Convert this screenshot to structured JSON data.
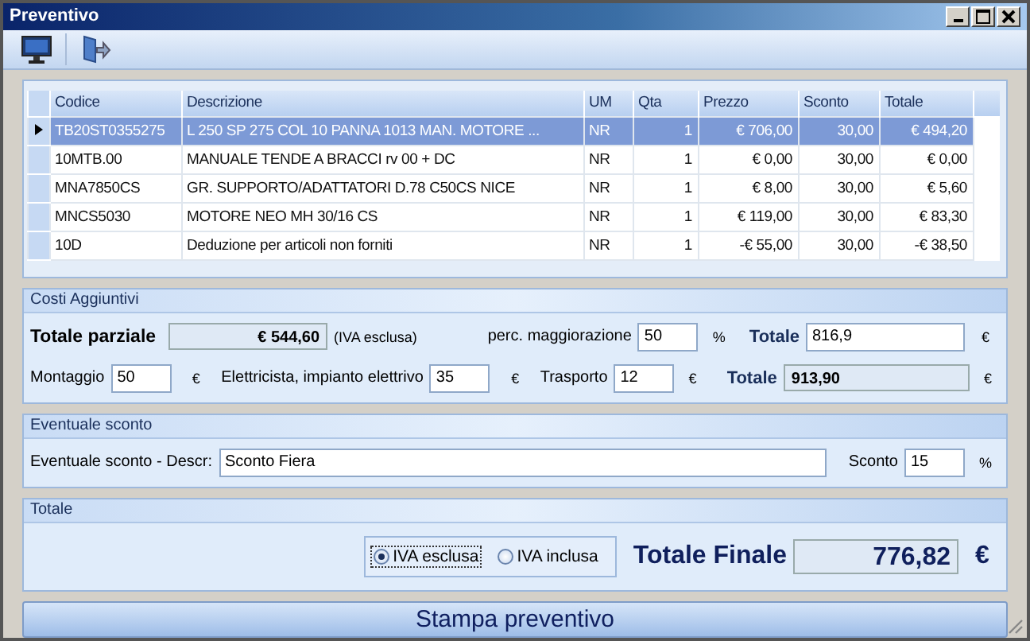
{
  "window": {
    "title": "Preventivo"
  },
  "table": {
    "columns": [
      "Codice",
      "Descrizione",
      "UM",
      "Qta",
      "Prezzo",
      "Sconto",
      "Totale"
    ],
    "rows": [
      {
        "cells": [
          "TB20ST0355275",
          "L 250 SP 275 COL 10 PANNA  1013 MAN. MOTORE ...",
          "NR",
          "1",
          "€ 706,00",
          "30,00",
          "€ 494,20"
        ],
        "selected": true
      },
      {
        "cells": [
          "10MTB.00",
          "MANUALE TENDE A BRACCI  rv 00 + DC",
          "NR",
          "1",
          "€ 0,00",
          "30,00",
          "€ 0,00"
        ],
        "selected": false
      },
      {
        "cells": [
          "MNA7850CS",
          "GR. SUPPORTO/ADATTATORI D.78 C50CS NICE",
          "NR",
          "1",
          "€ 8,00",
          "30,00",
          "€ 5,60"
        ],
        "selected": false
      },
      {
        "cells": [
          "MNCS5030",
          "MOTORE NEO MH 30/16 CS",
          "NR",
          "1",
          "€ 119,00",
          "30,00",
          "€ 83,30"
        ],
        "selected": false
      },
      {
        "cells": [
          "10D",
          "Deduzione per articoli non forniti",
          "NR",
          "1",
          "-€ 55,00",
          "30,00",
          "-€ 38,50"
        ],
        "selected": false
      }
    ]
  },
  "costi": {
    "title": "Costi Aggiuntivi",
    "subtotal_label": "Totale parziale",
    "subtotal": "€ 544,60",
    "subtotal_note": "(IVA esclusa)",
    "markup_label": "perc. maggiorazione",
    "markup": "50",
    "markup_unit": "%",
    "total_label": "Totale",
    "total": "816,9",
    "total_unit": "€",
    "montaggio_label": "Montaggio",
    "montaggio": "50",
    "montaggio_unit": "€",
    "elettricista_label": "Elettricista, impianto elettrivo",
    "elettricista": "35",
    "elettricista_unit": "€",
    "trasporto_label": "Trasporto",
    "trasporto": "12",
    "trasporto_unit": "€",
    "grand_label": "Totale",
    "grand": "913,90",
    "grand_unit": "€"
  },
  "sconto": {
    "title": "Eventuale sconto",
    "descr_label": "Eventuale sconto - Descr:",
    "descr": "Sconto Fiera",
    "label": "Sconto",
    "value": "15",
    "unit": "%"
  },
  "totale": {
    "title": "Totale",
    "options": [
      {
        "label": "IVA esclusa",
        "selected": true
      },
      {
        "label": "IVA inclusa",
        "selected": false
      }
    ],
    "final_label": "Totale Finale",
    "final": "776,82",
    "final_unit": "€"
  },
  "print_button": "Stampa preventivo"
}
